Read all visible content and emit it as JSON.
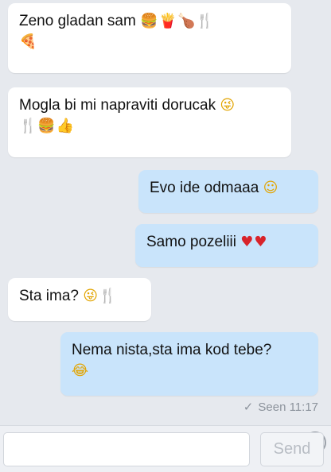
{
  "messages": [
    {
      "direction": "incoming",
      "text": "Zeno gladan sam",
      "emoji_inline": [
        "burger-emoji",
        "fries-emoji",
        "drumstick-emoji",
        "fork-knife-emoji"
      ],
      "emoji_line2": [
        "pizza-emoji"
      ]
    },
    {
      "direction": "incoming",
      "text": "Mogla bi mi napraviti dorucak",
      "emoji_inline": [
        "winking-tongue-emoji"
      ],
      "emoji_line2": [
        "fork-knife-emoji",
        "burger-emoji",
        "thumbs-up-emoji"
      ]
    },
    {
      "direction": "outgoing",
      "text": "Evo ide odmaaa",
      "emoji_inline": [
        "smiling-blush-emoji"
      ]
    },
    {
      "direction": "outgoing",
      "text": "Samo pozeliii",
      "emoji_inline": [
        "red-heart-emoji",
        "red-heart-emoji"
      ]
    },
    {
      "direction": "incoming",
      "text": "Sta ima?",
      "emoji_inline": [
        "winking-tongue-emoji",
        "fork-knife-emoji"
      ]
    },
    {
      "direction": "outgoing",
      "text": "Nema nista,sta ima kod tebe?",
      "emoji_line2": [
        "tears-of-joy-emoji"
      ]
    }
  ],
  "status": {
    "seen_label": "Seen 11:17"
  },
  "composer": {
    "input_value": "",
    "send_label": "Send"
  },
  "colors": {
    "incoming_bubble": "#ffffff",
    "outgoing_bubble": "#c9e4fb",
    "background": "#e6e9ee"
  }
}
